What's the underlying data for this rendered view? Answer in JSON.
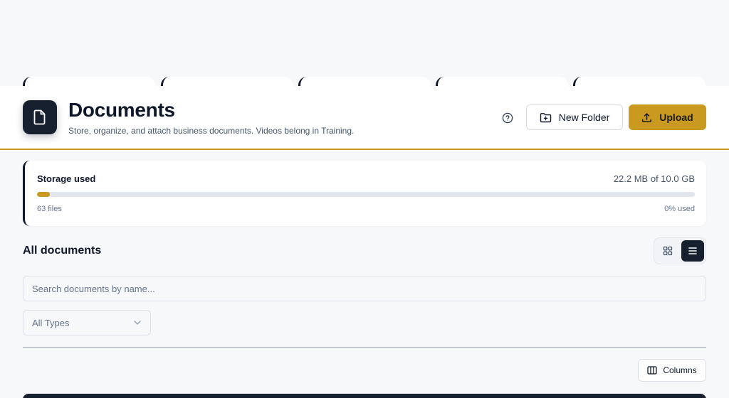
{
  "header": {
    "title": "Documents",
    "subtitle": "Store, organize, and attach business documents. Videos belong in Training.",
    "new_folder_label": "New Folder",
    "upload_label": "Upload",
    "icon": "file-icon",
    "help_icon": "help-circle-icon"
  },
  "storage": {
    "label": "Storage used",
    "amount": "22.2 MB of 10.0 GB",
    "files": "63 files",
    "percent": "0% used",
    "fill_fraction": 0.02
  },
  "section": {
    "title": "All documents"
  },
  "view_toggle": {
    "options": [
      "grid",
      "list"
    ],
    "selected": "list"
  },
  "search": {
    "placeholder": "Search documents by name..."
  },
  "filter": {
    "selected": "All Types"
  },
  "columns_label": "Columns",
  "colors": {
    "accent": "#c99a1f",
    "dark": "#16202f",
    "background": "#f7f8fa"
  }
}
